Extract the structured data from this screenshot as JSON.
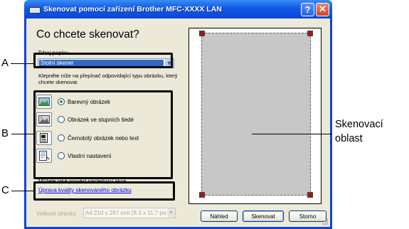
{
  "window": {
    "title": "Skenovat pomocí zařízení Brother  MFC-XXXX  LAN",
    "help_label": "?",
    "close_label": "✕"
  },
  "dialog": {
    "heading": "Co chcete skenovat?",
    "paper_source_label": "Zdroj papíru",
    "paper_source_value": "Stolní skener",
    "description": "Klepněte níže na přepínač odpovídající typu obrázku, který chcete skenovat.",
    "options": [
      {
        "label": "Barevný obrázek",
        "selected": true,
        "icon": "color-picture-icon"
      },
      {
        "label": "Obrázek ve stupních šedé",
        "selected": false,
        "icon": "grayscale-picture-icon"
      },
      {
        "label": "Černobílý obrázek nebo text",
        "selected": false,
        "icon": "black-white-text-icon"
      },
      {
        "label": "Vlastní nastavení",
        "selected": false,
        "icon": "custom-settings-icon"
      }
    ],
    "more_text": "Můžete také provést následující akce.",
    "quality_link": "Úprava kvality skenovaného obrázku",
    "page_size_label": "Velikost stránky:",
    "page_size_value": "A4 210 x 297 mm (8.3 x 11.7 pal",
    "buttons": {
      "preview": "Náhled",
      "scan": "Skenovat",
      "cancel": "Storno"
    }
  },
  "callouts": {
    "a": "A",
    "b": "B",
    "c": "C",
    "scan_area_line1": "Skenovací",
    "scan_area_line2": "oblast"
  },
  "colors": {
    "titlebar": "#0a46d8",
    "selection": "#316ac5",
    "dialog_bg": "#ece9d8",
    "link": "#0000ee",
    "handle": "#9b1a1a"
  }
}
